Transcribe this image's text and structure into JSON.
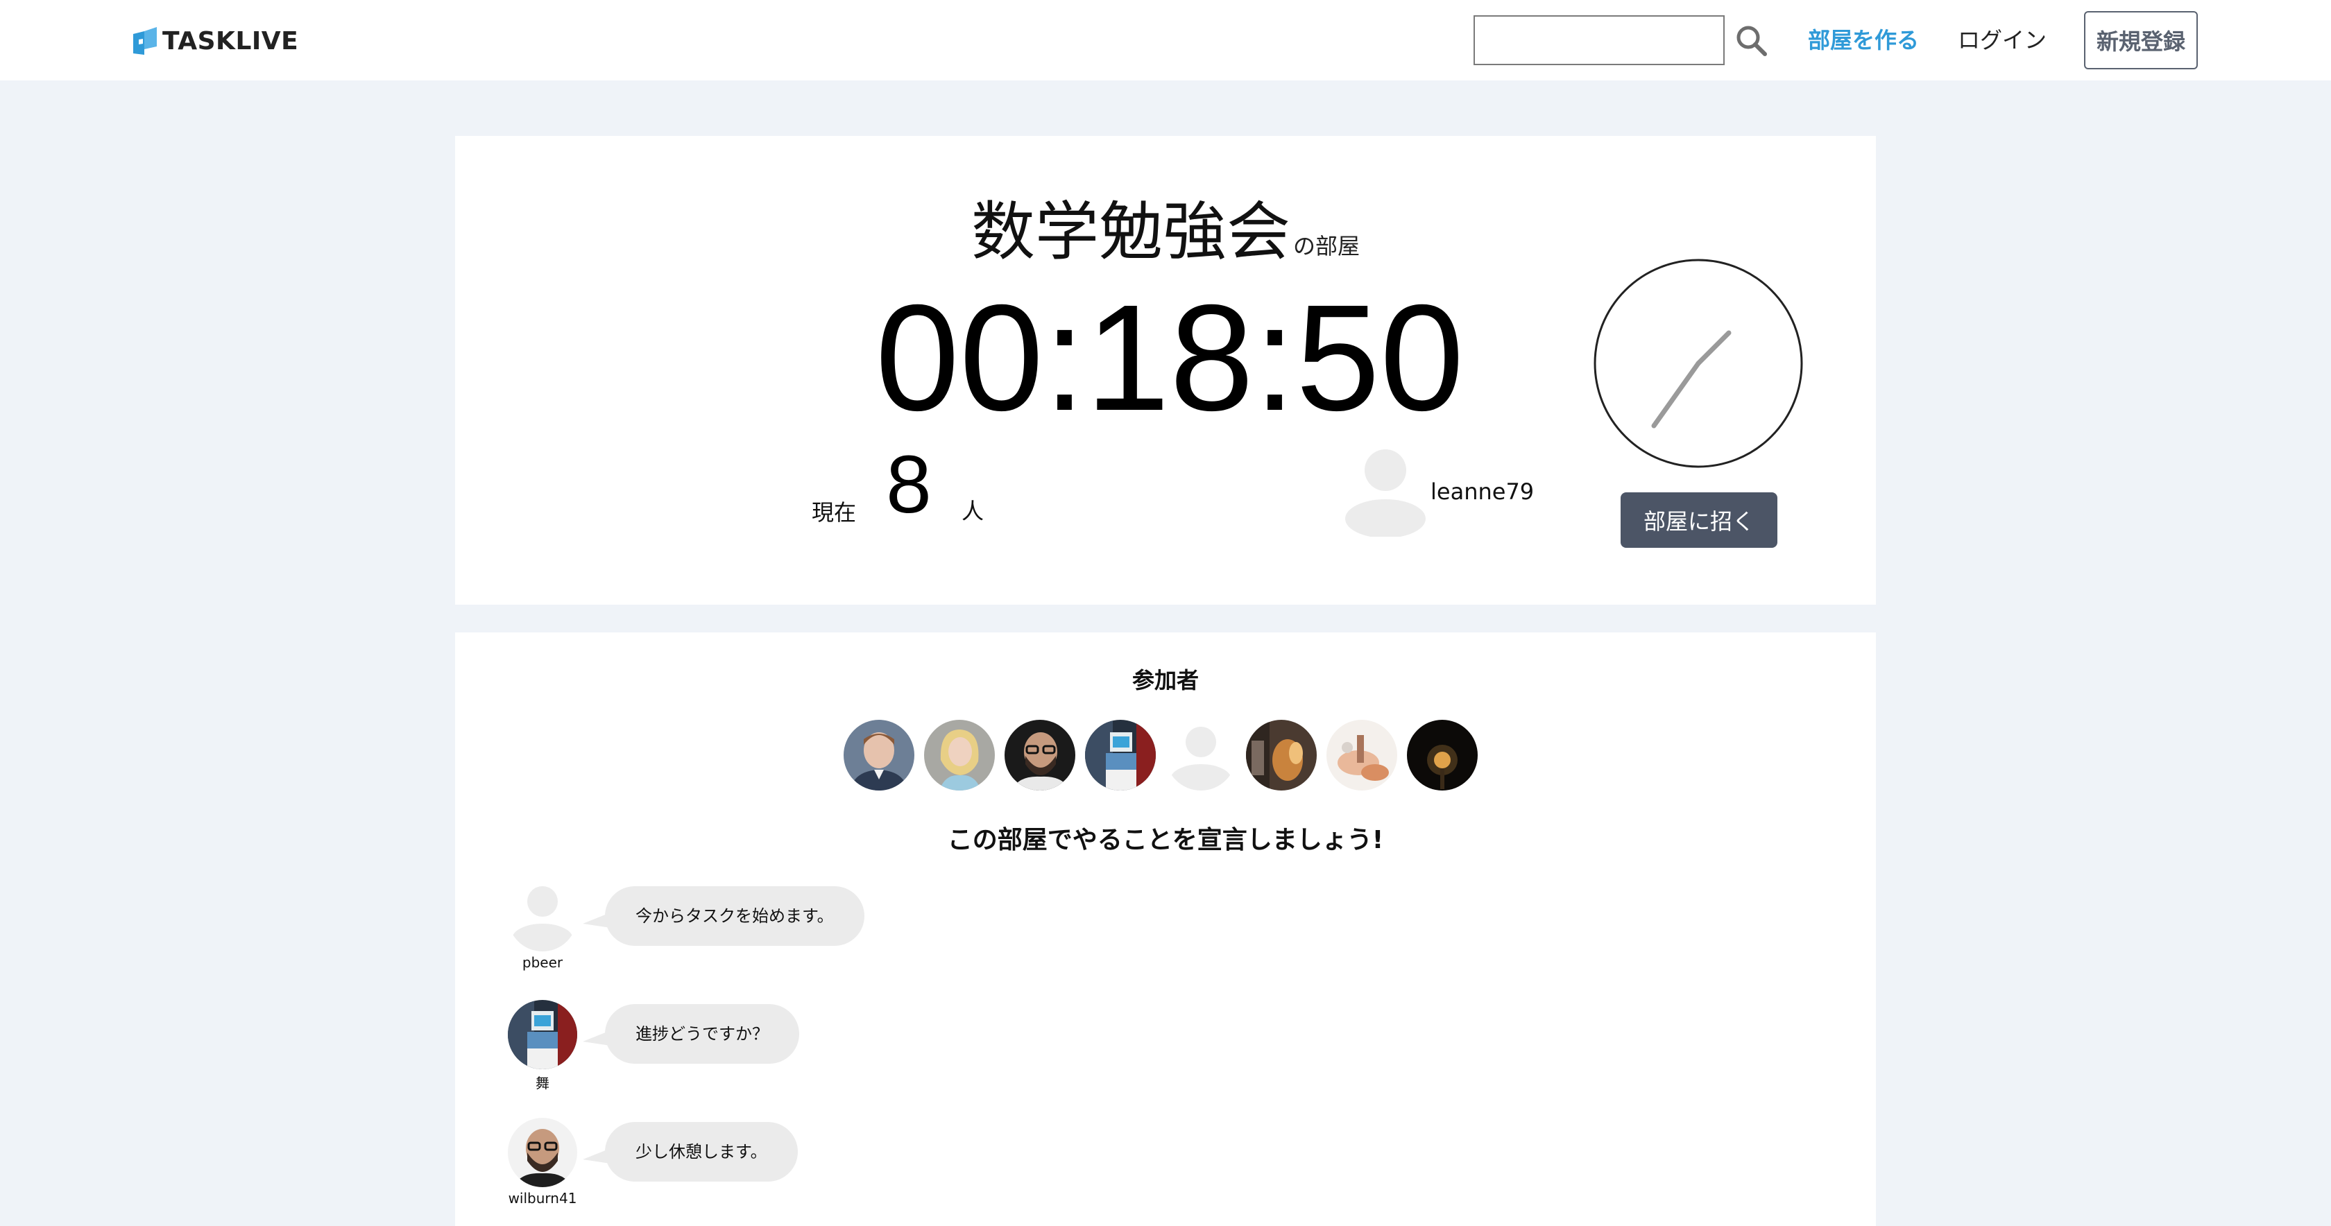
{
  "header": {
    "logo_text": "TASKLIVE",
    "search": {
      "value": "",
      "placeholder": ""
    },
    "nav": {
      "create_room": "部屋を作る",
      "login": "ログイン",
      "register": "新規登録"
    }
  },
  "room": {
    "name": "数学勉強会",
    "suffix": "の部屋",
    "timer": "00:18:50",
    "count_label": "現在",
    "count": "8",
    "count_unit": "人",
    "owner": "leanne79",
    "invite_button": "部屋に招く"
  },
  "participants": {
    "title": "参加者",
    "avatars": [
      {
        "icon": "avatar-young-man-icon"
      },
      {
        "icon": "avatar-blonde-woman-icon"
      },
      {
        "icon": "avatar-bald-man-glasses-icon"
      },
      {
        "icon": "avatar-figure-blue-icon"
      },
      {
        "icon": "avatar-default-icon"
      },
      {
        "icon": "avatar-warm-photo-icon"
      },
      {
        "icon": "avatar-light-photo-icon"
      },
      {
        "icon": "avatar-dark-photo-icon"
      }
    ]
  },
  "declaration": {
    "title": "この部屋でやることを宣言しましょう!",
    "messages": [
      {
        "user": "pbeer",
        "text": "今からタスクを始めます。",
        "icon": "avatar-default-icon"
      },
      {
        "user": "舞",
        "text": "進捗どうですか？",
        "icon": "avatar-figure-blue-icon"
      },
      {
        "user": "wilburn41",
        "text": "少し休憩します。",
        "icon": "avatar-bald-man-glasses-icon"
      }
    ]
  },
  "colors": {
    "accent": "#2f9ad8",
    "page_bg": "#eff3f8",
    "button_dark": "#4c5566",
    "bubble_bg": "#ebebeb"
  }
}
